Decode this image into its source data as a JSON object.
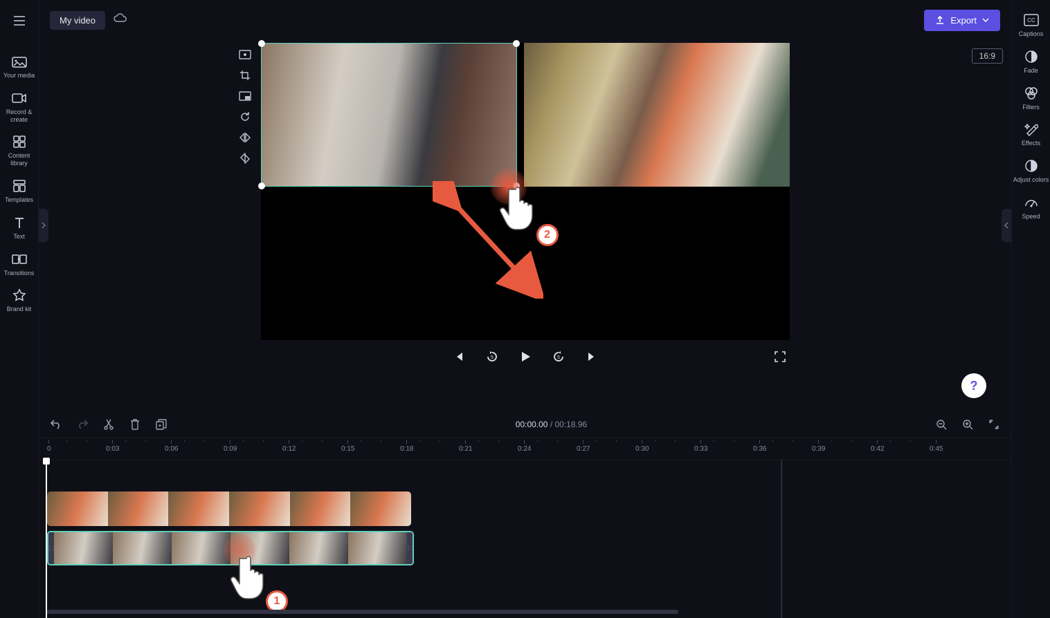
{
  "topbar": {
    "title": "My video",
    "export": "Export"
  },
  "aspect_ratio": "16:9",
  "left_sidebar": [
    {
      "label": "Your media",
      "icon": "media"
    },
    {
      "label": "Record & create",
      "icon": "record"
    },
    {
      "label": "Content library",
      "icon": "library"
    },
    {
      "label": "Templates",
      "icon": "templates"
    },
    {
      "label": "Text",
      "icon": "text"
    },
    {
      "label": "Transitions",
      "icon": "transitions"
    },
    {
      "label": "Brand kit",
      "icon": "brandkit"
    }
  ],
  "right_sidebar": [
    {
      "label": "Captions",
      "icon": "cc"
    },
    {
      "label": "Fade",
      "icon": "fade"
    },
    {
      "label": "Filters",
      "icon": "filters"
    },
    {
      "label": "Effects",
      "icon": "effects"
    },
    {
      "label": "Adjust colors",
      "icon": "adjust"
    },
    {
      "label": "Speed",
      "icon": "speed"
    }
  ],
  "playback": {
    "current": "00:00.00",
    "duration": "00:18.96"
  },
  "ruler_ticks": [
    "0",
    "0:03",
    "0:06",
    "0:09",
    "0:12",
    "0:15",
    "0:18",
    "0:21",
    "0:24",
    "0:27",
    "0:30",
    "0:33",
    "0:36",
    "0:39",
    "0:42",
    "0:45"
  ],
  "annotations": {
    "step1": "1",
    "step2": "2"
  }
}
